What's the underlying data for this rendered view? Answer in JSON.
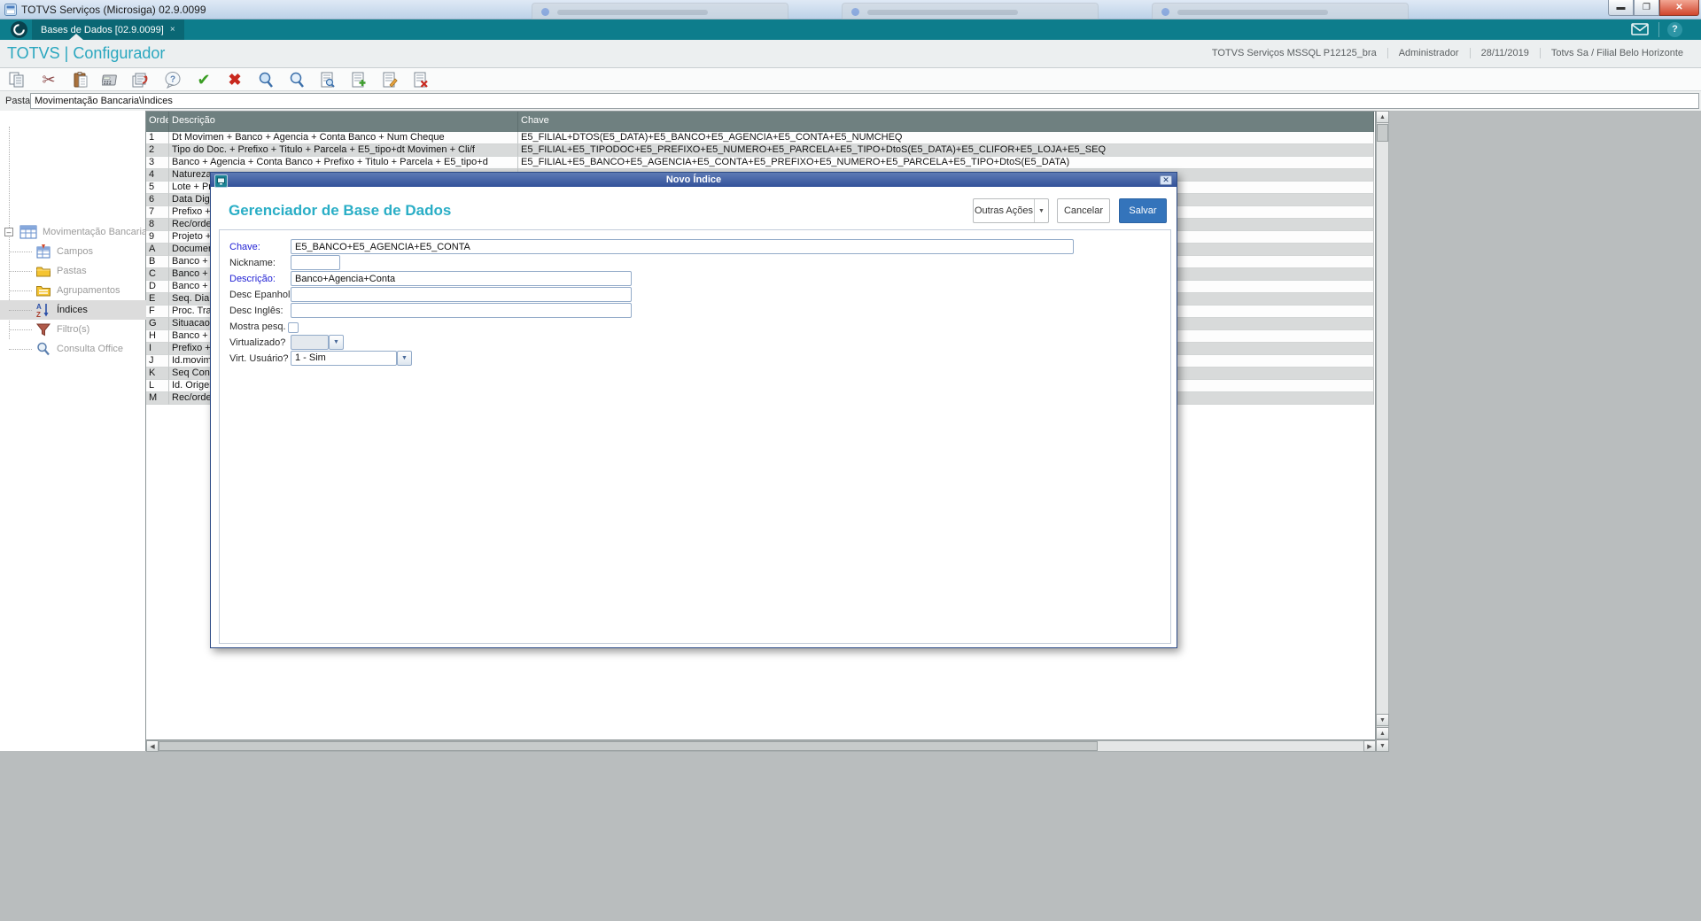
{
  "window": {
    "title": "TOTVS Serviços (Microsiga) 02.9.0099",
    "controls": [
      "minimize",
      "restore",
      "close"
    ]
  },
  "tabbar": {
    "tab_label": "Bases de Dados [02.9.0099]",
    "tab_close": "×"
  },
  "header": {
    "app_title": "TOTVS | Configurador",
    "environment": "TOTVS Serviços MSSQL P12125_bra",
    "user": "Administrador",
    "date": "28/11/2019",
    "company": "Totvs Sa / Filial Belo Horizonte"
  },
  "toolbar": {
    "icons": [
      "copy",
      "cut",
      "paste",
      "calculator",
      "print",
      "help",
      "confirm",
      "cancel",
      "search",
      "zoom",
      "view-document",
      "add-document",
      "edit-document",
      "delete-document"
    ]
  },
  "pasta": {
    "label": "Pasta",
    "value": "Movimentação Bancaria\\Índices"
  },
  "tree": {
    "root": "Movimentação Bancaria",
    "items": [
      {
        "label": "Campos",
        "icon": "table-fields-icon",
        "selected": false
      },
      {
        "label": "Pastas",
        "icon": "folder-icon",
        "selected": false
      },
      {
        "label": "Agrupamentos",
        "icon": "folder-group-icon",
        "selected": false
      },
      {
        "label": "Índices",
        "icon": "sort-az-icon",
        "selected": true
      },
      {
        "label": "Filtro(s)",
        "icon": "filter-icon",
        "selected": false
      },
      {
        "label": "Consulta Office",
        "icon": "search-icon",
        "selected": false
      }
    ]
  },
  "grid": {
    "columns": [
      "Ordem",
      "Descrição",
      "Chave"
    ],
    "rows": [
      {
        "ordem": "1",
        "descricao": "Dt Movimen + Banco + Agencia + Conta Banco + Num Cheque",
        "chave": "E5_FILIAL+DTOS(E5_DATA)+E5_BANCO+E5_AGENCIA+E5_CONTA+E5_NUMCHEQ"
      },
      {
        "ordem": "2",
        "descricao": "Tipo do Doc. + Prefixo + Titulo + Parcela + E5_tipo+dt Movimen + Cli/f",
        "chave": "E5_FILIAL+E5_TIPODOC+E5_PREFIXO+E5_NUMERO+E5_PARCELA+E5_TIPO+DtoS(E5_DATA)+E5_CLIFOR+E5_LOJA+E5_SEQ"
      },
      {
        "ordem": "3",
        "descricao": "Banco + Agencia + Conta Banco + Prefixo + Titulo + Parcela + E5_tipo+d",
        "chave": "E5_FILIAL+E5_BANCO+E5_AGENCIA+E5_CONTA+E5_PREFIXO+E5_NUMERO+E5_PARCELA+E5_TIPO+DtoS(E5_DATA)"
      },
      {
        "ordem": "4",
        "descricao": "Natureza",
        "chave": ""
      },
      {
        "ordem": "5",
        "descricao": "Lote + Pr",
        "chave": ""
      },
      {
        "ordem": "6",
        "descricao": "Data Digit",
        "chave": ""
      },
      {
        "ordem": "7",
        "descricao": "Prefixo +",
        "chave": ""
      },
      {
        "ordem": "8",
        "descricao": "Rec/orde",
        "chave": ""
      },
      {
        "ordem": "9",
        "descricao": "Projeto +",
        "chave": ""
      },
      {
        "ordem": "A",
        "descricao": "Documen",
        "chave": ""
      },
      {
        "ordem": "B",
        "descricao": "Banco + A",
        "chave": ""
      },
      {
        "ordem": "C",
        "descricao": "Banco + A",
        "chave": ""
      },
      {
        "ordem": "D",
        "descricao": "Banco + I",
        "chave": ""
      },
      {
        "ordem": "E",
        "descricao": "Seq. Diar",
        "chave": ""
      },
      {
        "ordem": "F",
        "descricao": "Proc. Tra",
        "chave": ""
      },
      {
        "ordem": "G",
        "descricao": "Situacao",
        "chave": ""
      },
      {
        "ordem": "H",
        "descricao": "Banco + A",
        "chave": ""
      },
      {
        "ordem": "I",
        "descricao": "Prefixo +",
        "chave": ""
      },
      {
        "ordem": "J",
        "descricao": "Id.movime",
        "chave": ""
      },
      {
        "ordem": "K",
        "descricao": "Seq Conc",
        "chave": ""
      },
      {
        "ordem": "L",
        "descricao": "Id. Origen",
        "chave": ""
      },
      {
        "ordem": "M",
        "descricao": "Rec/orde",
        "chave": ""
      }
    ]
  },
  "modal": {
    "title": "Novo Índice",
    "heading": "Gerenciador de Base de Dados",
    "buttons": {
      "outras_acoes": "Outras Ações",
      "cancelar": "Cancelar",
      "salvar": "Salvar"
    },
    "fields": {
      "chave": {
        "label": "Chave:",
        "value": "E5_BANCO+E5_AGENCIA+E5_CONTA"
      },
      "nickname": {
        "label": "Nickname:",
        "value": ""
      },
      "descricao": {
        "label": "Descrição:",
        "value": "Banco+Agencia+Conta"
      },
      "desc_epanhol": {
        "label": "Desc Epanhol:",
        "value": ""
      },
      "desc_ingles": {
        "label": "Desc Inglês:",
        "value": ""
      },
      "mostra_pesq": {
        "label": "Mostra pesq.",
        "checked": false
      },
      "virtualizado": {
        "label": "Virtualizado?",
        "value": ""
      },
      "virt_usuario": {
        "label": "Virt. Usuário?",
        "value": "1 - Sim"
      }
    }
  },
  "colors": {
    "teal_bar": "#0d7d8c",
    "accent_teal": "#2aa7bf",
    "grid_header": "#6f8080",
    "modal_title_blue": "#33529a",
    "save_button_blue": "#3474bb",
    "required_label_blue": "#1f1fd4"
  }
}
